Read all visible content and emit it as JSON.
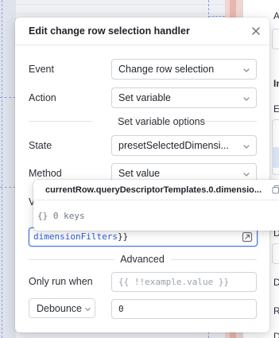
{
  "modal": {
    "title": "Edit change row selection handler",
    "fields": {
      "event": {
        "label": "Event",
        "value": "Change row selection"
      },
      "action": {
        "label": "Action",
        "value": "Set variable"
      },
      "state": {
        "label": "State",
        "value": "presetSelectedDimensi..."
      },
      "method": {
        "label": "Method",
        "value": "Set value"
      },
      "value_label_partial": "V"
    },
    "set_variable_heading": "Set variable options",
    "value_code": {
      "token_open": "dimensionFilters",
      "token_close": "}}"
    },
    "advanced_heading": "Advanced",
    "only_run_when": {
      "label": "Only run when",
      "placeholder": "{{ !!example.value }}"
    },
    "debounce": {
      "label": "Debounce",
      "value": "0"
    }
  },
  "autocomplete": {
    "suggestion": "currentRow.queryDescriptorTemplates.0.dimensio...",
    "info": "{} 0 keys"
  },
  "right_panel": {
    "letters": [
      "A",
      "In",
      "E",
      "D",
      "D",
      "R",
      "D"
    ]
  },
  "icons": [
    "close-icon",
    "chevron-down-icon",
    "expand-icon",
    "copy-icon"
  ],
  "colors": {
    "accent": "#4a74e0",
    "code_token": "#2b5fd9",
    "dashed_guide": "#8ea0e0",
    "pink_strip": "#f1d6d2"
  }
}
